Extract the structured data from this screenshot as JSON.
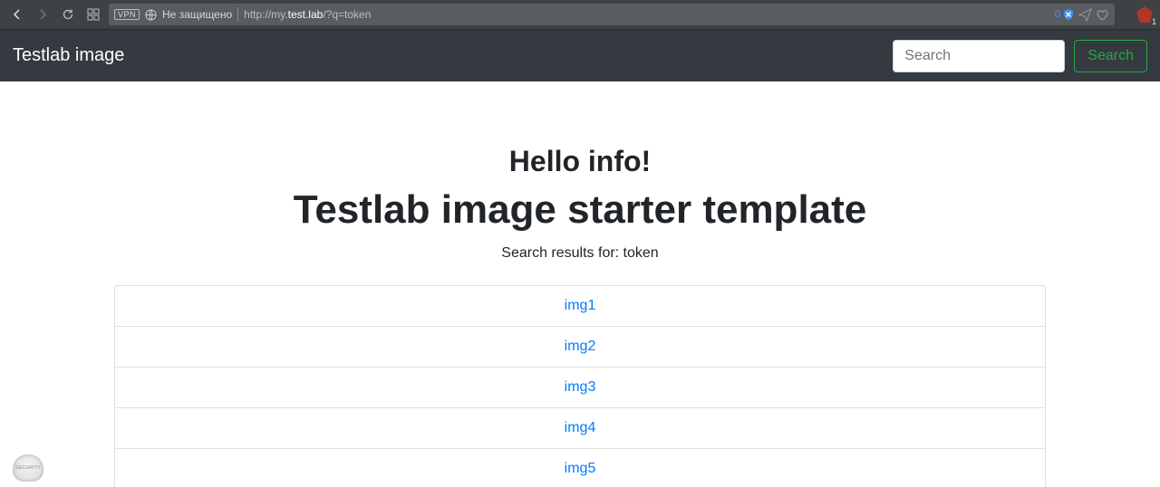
{
  "chrome": {
    "vpn_label": "VPN",
    "security_text": "Не защищено",
    "url_prefix": "http://my.",
    "url_host": "test.lab",
    "url_suffix": "/?q=token",
    "right_count": "0",
    "ext_badge": "1"
  },
  "navbar": {
    "brand": "Testlab image",
    "search_placeholder": "Search",
    "search_button": "Search"
  },
  "content": {
    "greeting": "Hello info!",
    "title": "Testlab image starter template",
    "subtitle": "Search results for: token",
    "results": [
      "img1",
      "img2",
      "img3",
      "img4",
      "img5"
    ]
  }
}
